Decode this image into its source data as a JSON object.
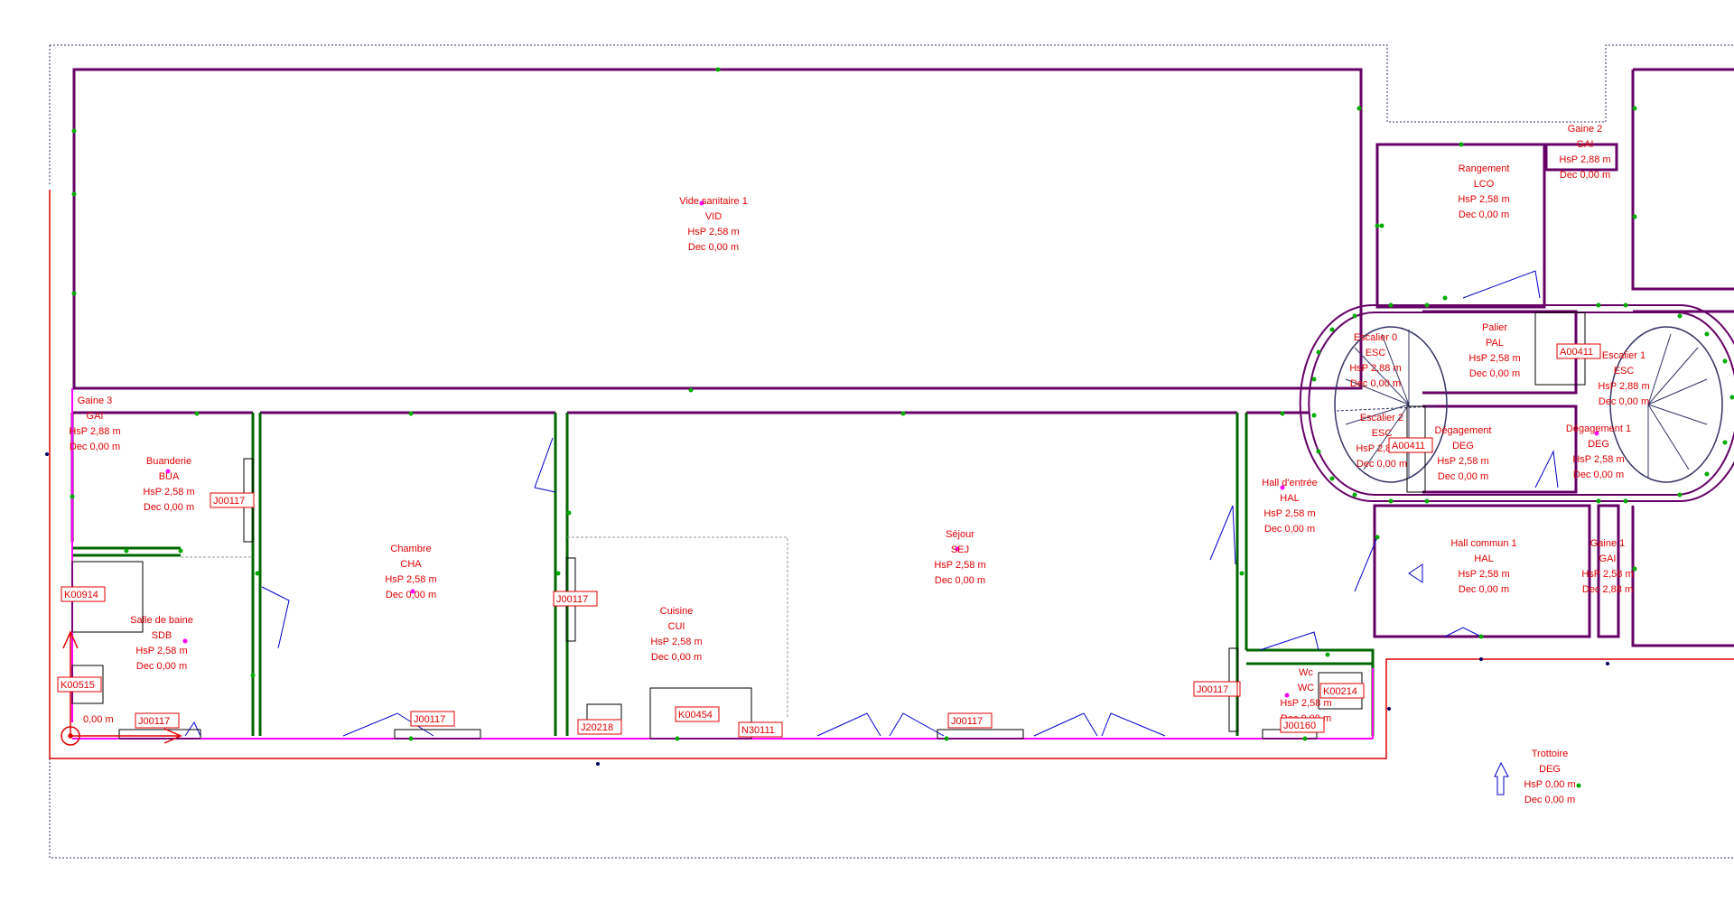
{
  "colors": {
    "wall_purple": "#660066",
    "wall_green": "#006600",
    "wall_magenta": "#ff00ff",
    "door_blue": "#0000cc",
    "outline_red": "#e00000",
    "label_red": "#e00000",
    "node_green": "#00aa00",
    "dotted_black": "#333366",
    "background": "#ffffff"
  },
  "rooms": [
    {
      "id": "vid",
      "lines": [
        "Vide sanitaire 1",
        "VID",
        "HsP 2,58 m",
        "Dec 0,00 m"
      ]
    },
    {
      "id": "gai-2",
      "lines": [
        "Gaine 2",
        "GAI",
        "HsP 2,88 m",
        "Dec 0,00 m"
      ]
    },
    {
      "id": "lco",
      "lines": [
        "Rangement",
        "LCO",
        "HsP 2,58 m",
        "Dec 0,00 m"
      ]
    },
    {
      "id": "gai-3",
      "lines": [
        "Gaine 3",
        "GAI",
        "HsP 2,88 m",
        "Dec 0,00 m"
      ]
    },
    {
      "id": "bua",
      "lines": [
        "Buanderie",
        "BUA",
        "HsP 2,58 m",
        "Dec 0,00 m"
      ]
    },
    {
      "id": "cha",
      "lines": [
        "Chambre",
        "CHA",
        "HsP 2,58 m",
        "Dec 0,00 m"
      ]
    },
    {
      "id": "sej",
      "lines": [
        "Séjour",
        "SEJ",
        "HsP 2,58 m",
        "Dec 0,00 m"
      ]
    },
    {
      "id": "cui",
      "lines": [
        "Cuisine",
        "CUI",
        "HsP 2,58 m",
        "Dec 0,00 m"
      ]
    },
    {
      "id": "sdb",
      "lines": [
        "Salle de baine",
        "SDB",
        "HsP 2,58 m",
        "Dec 0,00 m"
      ]
    },
    {
      "id": "hal-entree",
      "lines": [
        "Hall d'entrée",
        "HAL",
        "HsP 2,58 m",
        "Dec 0,00 m"
      ]
    },
    {
      "id": "pal",
      "lines": [
        "Palier",
        "PAL",
        "HsP 2,58 m",
        "Dec 0,00 m"
      ]
    },
    {
      "id": "esc-0",
      "lines": [
        "Escalier 0",
        "ESC",
        "HsP 2,88 m",
        "Dec 0,00 m"
      ]
    },
    {
      "id": "esc-1",
      "lines": [
        "Escalier 1",
        "ESC",
        "HsP 2,88 m",
        "Dec 0,00 m"
      ]
    },
    {
      "id": "esc-2",
      "lines": [
        "Escalier 2",
        "ESC",
        "HsP 2,88 m",
        "Dec 0,00 m"
      ]
    },
    {
      "id": "deg",
      "lines": [
        "Dégagement",
        "DEG",
        "HsP 2,58 m",
        "Dec 0,00 m"
      ]
    },
    {
      "id": "deg-1",
      "lines": [
        "Dégagement 1",
        "DEG",
        "HsP 2,58 m",
        "Dec 0,00 m"
      ]
    },
    {
      "id": "hal-commun",
      "lines": [
        "Hall commun 1",
        "HAL",
        "HsP 2,58 m",
        "Dec 0,00 m"
      ]
    },
    {
      "id": "gai-1",
      "lines": [
        "Gaine 1",
        "GAI",
        "HsP 2,58 m",
        "Dec 2,88 m"
      ]
    },
    {
      "id": "wc",
      "lines": [
        "Wc",
        "WC",
        "HsP 2,58 m",
        "Dec 0,00 m"
      ]
    },
    {
      "id": "trottoir",
      "lines": [
        "Trottoire",
        "DEG",
        "HsP 0,00 m",
        "Dec 0,00 m"
      ]
    }
  ],
  "tags": [
    {
      "id": "t1",
      "text": "J00117"
    },
    {
      "id": "t2",
      "text": "J00117"
    },
    {
      "id": "t3",
      "text": "J00117"
    },
    {
      "id": "t4",
      "text": "J00117"
    },
    {
      "id": "t5",
      "text": "J00117"
    },
    {
      "id": "t6",
      "text": "J00117"
    },
    {
      "id": "t7",
      "text": "K00914"
    },
    {
      "id": "t8",
      "text": "K00515"
    },
    {
      "id": "t9",
      "text": "J20218"
    },
    {
      "id": "t10",
      "text": "K00454"
    },
    {
      "id": "t11",
      "text": "N30111"
    },
    {
      "id": "t12",
      "text": "J00117"
    },
    {
      "id": "t13",
      "text": "K00214"
    },
    {
      "id": "t14",
      "text": "J00160"
    },
    {
      "id": "t15",
      "text": "A00411"
    },
    {
      "id": "t16",
      "text": "A00411"
    }
  ],
  "origin_label": "0,00 m"
}
